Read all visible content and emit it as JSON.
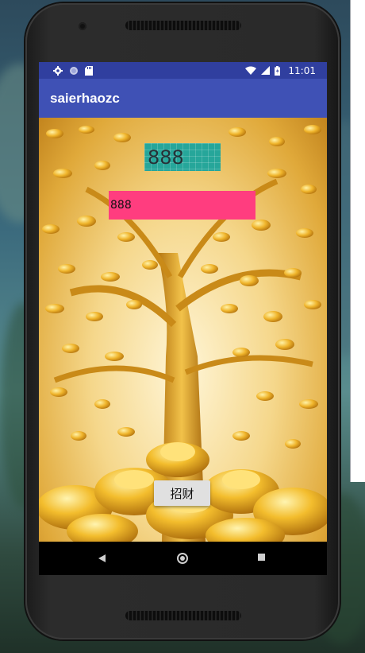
{
  "status_bar": {
    "time": "11:01",
    "icons_left": [
      "gear-icon",
      "circle-icon",
      "sd-card-icon"
    ],
    "icons_right": [
      "wifi-icon",
      "signal-icon",
      "battery-icon"
    ]
  },
  "app_bar": {
    "title": "saierhaozc"
  },
  "content": {
    "teal_text": "888",
    "pink_text": "888",
    "button_label": "招财",
    "fab_icon": "email-icon",
    "background": "money-tree-gold-ingots"
  },
  "nav_bar": {
    "items": [
      "back-icon",
      "home-icon",
      "recents-icon"
    ]
  },
  "colors": {
    "status_bar": "#303f9f",
    "app_bar": "#3f51b5",
    "teal_box": "#26a69a",
    "pink_box": "#ff3d7f",
    "fab": "#ff4081"
  }
}
